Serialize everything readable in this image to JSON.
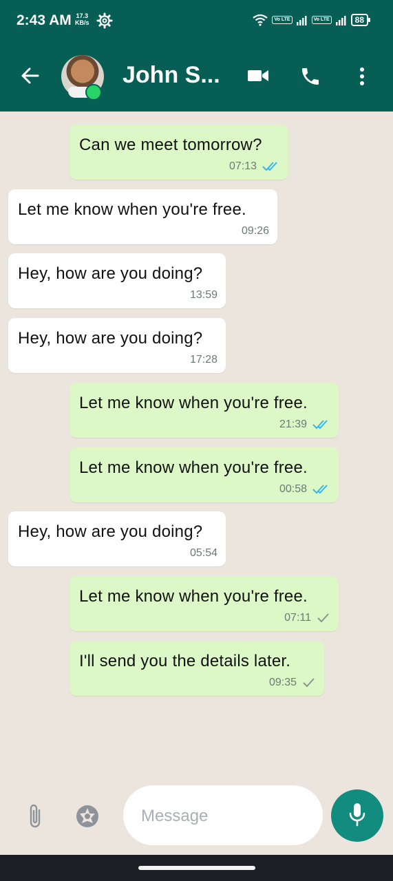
{
  "status_bar": {
    "time": "2:43 AM",
    "speed_value": "17.3",
    "speed_unit": "KB/s",
    "volte1": "Vo LTE",
    "volte2": "Vo LTE",
    "battery": "88"
  },
  "header": {
    "contact_name": "John S...",
    "online": true
  },
  "messages": [
    {
      "text": "Can we meet tomorrow?",
      "time": "07:13",
      "direction": "outgoing",
      "ticks": "read"
    },
    {
      "text": "Let me know when you're free.",
      "time": "09:26",
      "direction": "incoming"
    },
    {
      "text": "Hey, how are you doing?",
      "time": "13:59",
      "direction": "incoming"
    },
    {
      "text": "Hey, how are you doing?",
      "time": "17:28",
      "direction": "incoming"
    },
    {
      "text": "Let me know when you're free.",
      "time": "21:39",
      "direction": "outgoing",
      "ticks": "read"
    },
    {
      "text": "Let me know when you're free.",
      "time": "00:58",
      "direction": "outgoing",
      "ticks": "read"
    },
    {
      "text": "Hey, how are you doing?",
      "time": "05:54",
      "direction": "incoming"
    },
    {
      "text": "Let me know when you're free.",
      "time": "07:11",
      "direction": "outgoing",
      "ticks": "sent"
    },
    {
      "text": "I'll send you the details later.",
      "time": "09:35",
      "direction": "outgoing",
      "ticks": "sent"
    }
  ],
  "composer": {
    "placeholder": "Message",
    "value": ""
  },
  "icons": {
    "back": "arrow-left-icon",
    "video": "video-camera-icon",
    "call": "phone-icon",
    "menu": "more-vertical-icon",
    "attach": "paperclip-icon",
    "camera": "camera-shutter-icon",
    "mic": "microphone-icon"
  },
  "colors": {
    "header": "#075e54",
    "background": "#ece5dd",
    "outgoing_bubble": "#dcf8c6",
    "incoming_bubble": "#ffffff",
    "read_tick": "#34b7f1",
    "mic_button": "#128c7e",
    "online": "#25d366"
  }
}
